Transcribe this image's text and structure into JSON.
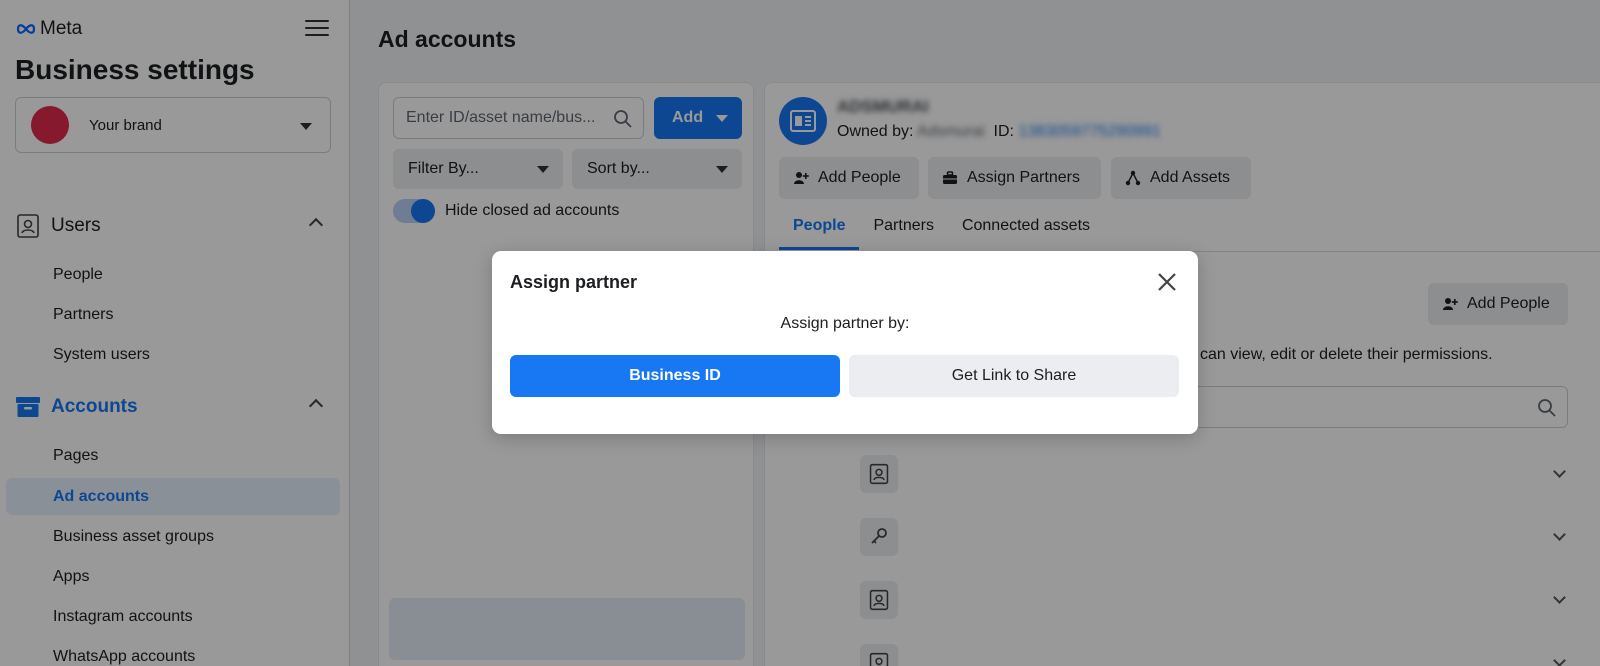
{
  "sidebar": {
    "logo_text": "Meta",
    "title": "Business settings",
    "brand_name": "Your brand",
    "users_section": "Users",
    "users_items": [
      "People",
      "Partners",
      "System users"
    ],
    "accounts_section": "Accounts",
    "accounts_items": [
      "Pages",
      "Ad accounts",
      "Business asset groups",
      "Apps",
      "Instagram accounts",
      "WhatsApp accounts"
    ],
    "active_item": "Ad accounts"
  },
  "main": {
    "title": "Ad accounts",
    "search_placeholder": "Enter ID/asset name/bus...",
    "add_label": "Add",
    "filter_label": "Filter By...",
    "sort_label": "Sort by...",
    "toggle_label": "Hide closed ad accounts",
    "account_name": "ADSMURAI",
    "owned_by_label": "Owned by:",
    "owner_name": "Adsmurai",
    "id_label": "ID:",
    "account_id": "1383059775290991",
    "action_add_people": "Add People",
    "action_assign_partners": "Assign Partners",
    "action_add_assets": "Add Assets",
    "tabs": [
      "People",
      "Partners",
      "Connected assets"
    ],
    "active_tab": "People",
    "add_people_label": "Add People",
    "permission_text": "can view, edit or delete their permissions."
  },
  "modal": {
    "title": "Assign partner",
    "subtitle": "Assign partner by:",
    "primary_label": "Business ID",
    "secondary_label": "Get Link to Share"
  },
  "colors": {
    "accent": "#1877f2",
    "brand_dot": "#e22a4d"
  }
}
